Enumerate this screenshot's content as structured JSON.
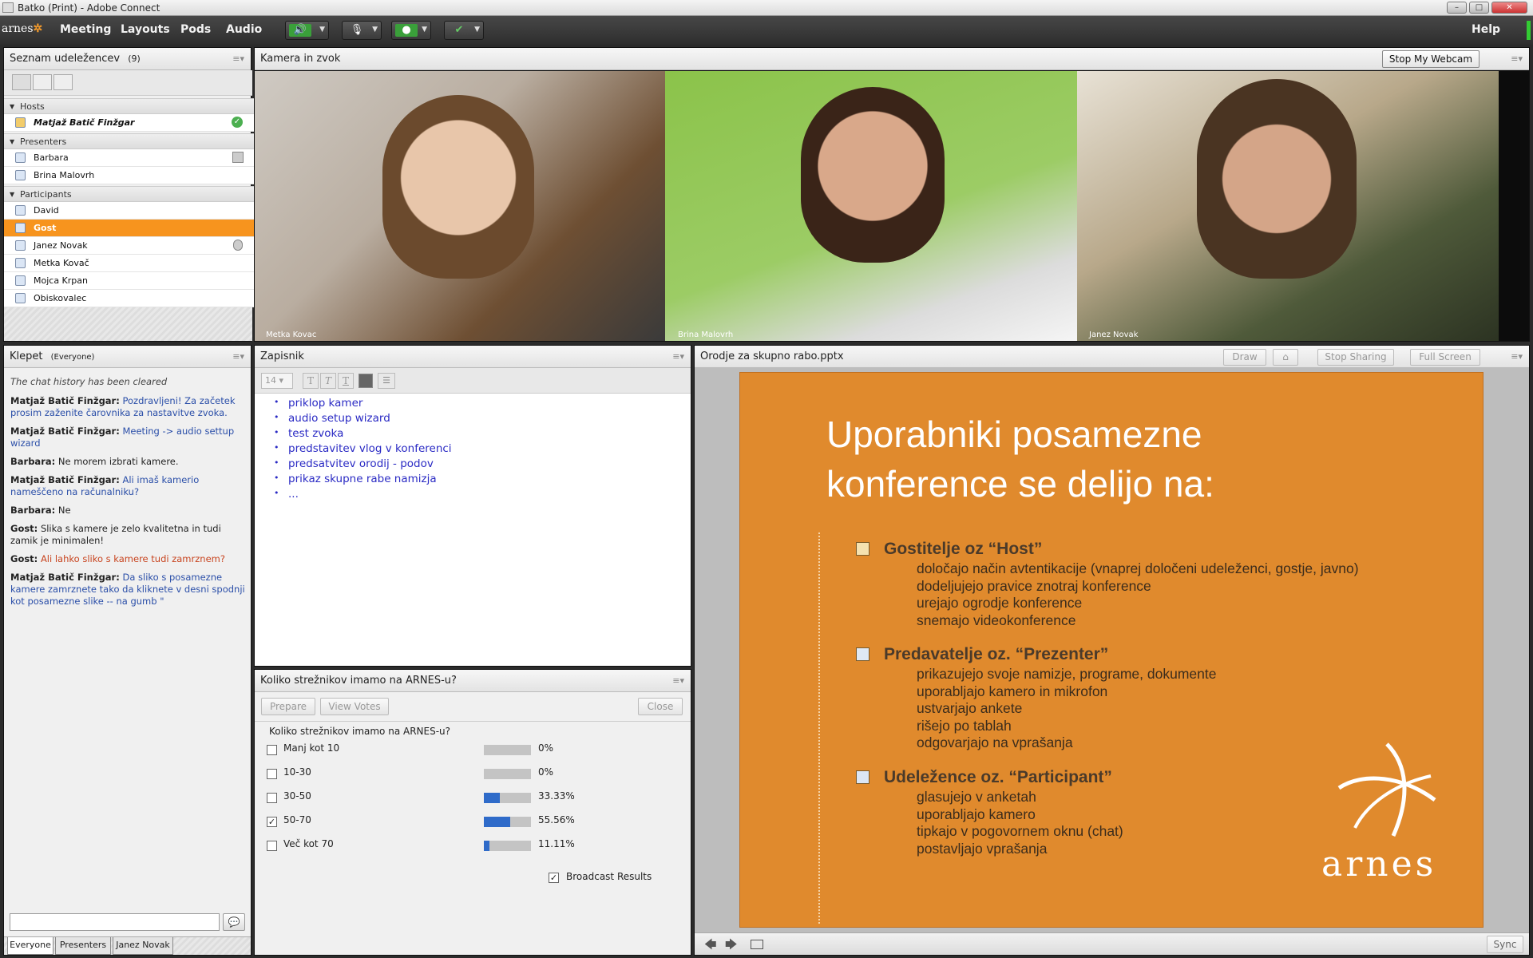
{
  "window": {
    "title": "Batko (Print) - Adobe Connect"
  },
  "menubar": {
    "logo": "arnes",
    "items": [
      "Meeting",
      "Layouts",
      "Pods",
      "Audio"
    ],
    "help": "Help"
  },
  "attendees": {
    "title": "Seznam udeležencev",
    "count": "(9)",
    "hosts_label": "Hosts",
    "hosts": [
      "Matjaž Batič Finžgar"
    ],
    "presenters_label": "Presenters",
    "presenters": [
      "Barbara",
      "Brina Malovrh"
    ],
    "participants_label": "Participants",
    "participants": [
      "David",
      "Gost",
      "Janez Novak",
      "Metka Kovač",
      "Mojca Krpan",
      "Obiskovalec"
    ]
  },
  "camera": {
    "title": "Kamera in zvok",
    "stop_btn": "Stop My Webcam",
    "feeds": [
      "Metka Kovac",
      "Brina Malovrh",
      "Janez Novak"
    ]
  },
  "chat": {
    "title": "Klepet",
    "scope": "(Everyone)",
    "cleared": "The chat history has been cleared",
    "messages": [
      {
        "name": "Matjaž Batič Finžgar:",
        "text": "Pozdravljeni! Za začetek prosim zaženite čarovnika za nastavitve zvoka."
      },
      {
        "name": "Matjaž Batič Finžgar:",
        "text": "Meeting -> audio settup wizard"
      },
      {
        "name": "Barbara:",
        "text": "Ne morem izbrati kamere."
      },
      {
        "name": "Matjaž Batič Finžgar:",
        "text": "Ali imaš kamerio nameščeno na računalniku?"
      },
      {
        "name": "Barbara:",
        "text": "Ne"
      },
      {
        "name": "Gost:",
        "text": "Slika s kamere je zelo kvalitetna in tudi zamik je minimalen!"
      },
      {
        "name": "Gost:",
        "text": "Ali lahko sliko s kamere tudi zamrznem?"
      },
      {
        "name": "Matjaž Batič Finžgar:",
        "text": "Da sliko s posamezne kamere zamrznete tako da kliknete v desni spodnji kot posamezne slike -- na gumb \""
      }
    ],
    "tabs": [
      "Everyone",
      "Presenters",
      "Janez Novak"
    ]
  },
  "notes": {
    "title": "Zapisnik",
    "font_size": "14",
    "items": [
      "priklop kamer",
      "audio setup wizard",
      "test zvoka",
      "predstavitev vlog v konferenci",
      "predsatvitev orodij - podov",
      "prikaz skupne rabe namizja",
      "..."
    ]
  },
  "poll": {
    "title": "Koliko strežnikov imamo na ARNES-u?",
    "question": "Koliko strežnikov imamo na ARNES-u?",
    "prepare": "Prepare",
    "view_votes": "View Votes",
    "close": "Close",
    "options": [
      {
        "label": "Manj kot 10",
        "pct": "0%",
        "value": 0,
        "checked": false
      },
      {
        "label": "10-30",
        "pct": "0%",
        "value": 0,
        "checked": false
      },
      {
        "label": "30-50",
        "pct": "33.33%",
        "value": 33.33,
        "checked": false
      },
      {
        "label": "50-70",
        "pct": "55.56%",
        "value": 55.56,
        "checked": true
      },
      {
        "label": "Več kot 70",
        "pct": "11.11%",
        "value": 11.11,
        "checked": false
      }
    ],
    "broadcast": "Broadcast Results"
  },
  "share": {
    "title": "Orodje za skupno rabo.pptx",
    "draw": "Draw",
    "stop_sharing": "Stop Sharing",
    "full_screen": "Full Screen",
    "sync": "Sync",
    "slide": {
      "title_line1": "Uporabniki posamezne",
      "title_line2": "konference se delijo na:",
      "groups": [
        {
          "heading": "Gostitelje oz “Host”",
          "lines": [
            "določajo način avtentikacije (vnaprej določeni udeleženci, gostje, javno)",
            "dodeljujejo pravice znotraj konference",
            "urejajo ogrodje konference",
            "snemajo videokonference"
          ]
        },
        {
          "heading": "Predavatelje oz. “Prezenter”",
          "lines": [
            "prikazujejo svoje namizje, programe, dokumente",
            "uporabljajo kamero in mikrofon",
            "ustvarjajo ankete",
            "rišejo po tablah",
            "odgovarjajo na vprašanja"
          ]
        },
        {
          "heading": "Udeležence oz. “Participant”",
          "lines": [
            "glasujejo v anketah",
            "uporabljajo kamero",
            "tipkajo v pogovornem oknu (chat)",
            "postavljajo vprašanja"
          ]
        }
      ],
      "logo": "arnes"
    }
  },
  "colors": {
    "accent": "#f7941e",
    "slide_bg": "#e08a2d",
    "poll_bar": "#2f6bc9",
    "link_blue": "#2a4ea8"
  }
}
